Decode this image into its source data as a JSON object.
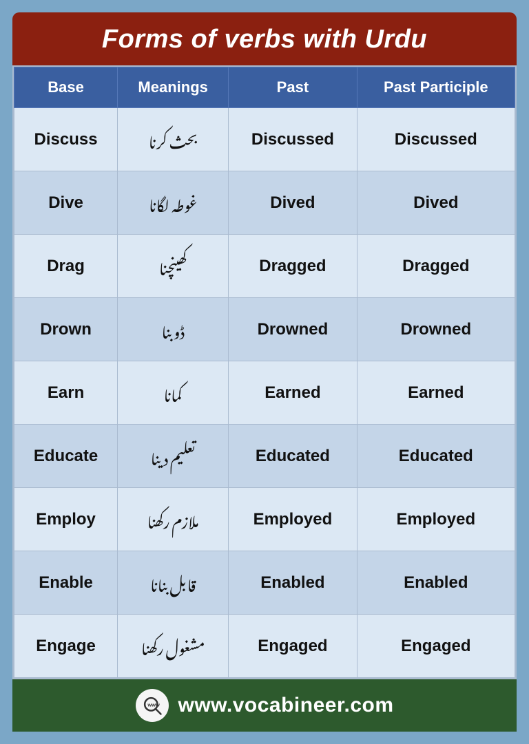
{
  "page": {
    "title": "Forms of verbs with Urdu",
    "background_color": "#7ba7c7"
  },
  "table": {
    "headers": [
      "Base",
      "Meanings",
      "Past",
      "Past Participle"
    ],
    "rows": [
      {
        "base": "Discuss",
        "meaning": "بحث کرنا",
        "past": "Discussed",
        "past_participle": "Discussed"
      },
      {
        "base": "Dive",
        "meaning": "غوطہ لگانا",
        "past": "Dived",
        "past_participle": "Dived"
      },
      {
        "base": "Drag",
        "meaning": "کھینچنا",
        "past": "Dragged",
        "past_participle": "Dragged"
      },
      {
        "base": "Drown",
        "meaning": "ڈوبنا",
        "past": "Drowned",
        "past_participle": "Drowned"
      },
      {
        "base": "Earn",
        "meaning": "کمانا",
        "past": "Earned",
        "past_participle": "Earned"
      },
      {
        "base": "Educate",
        "meaning": "تعلیم دینا",
        "past": "Educated",
        "past_participle": "Educated"
      },
      {
        "base": "Employ",
        "meaning": "ملازم رکھنا",
        "past": "Employed",
        "past_participle": "Employed"
      },
      {
        "base": "Enable",
        "meaning": "قابل بنانا",
        "past": "Enabled",
        "past_participle": "Enabled"
      },
      {
        "base": "Engage",
        "meaning": "مشغول رکھنا",
        "past": "Engaged",
        "past_participle": "Engaged"
      }
    ]
  },
  "footer": {
    "url": "www.vocabineer.com",
    "icon_label": "www-search-icon"
  }
}
